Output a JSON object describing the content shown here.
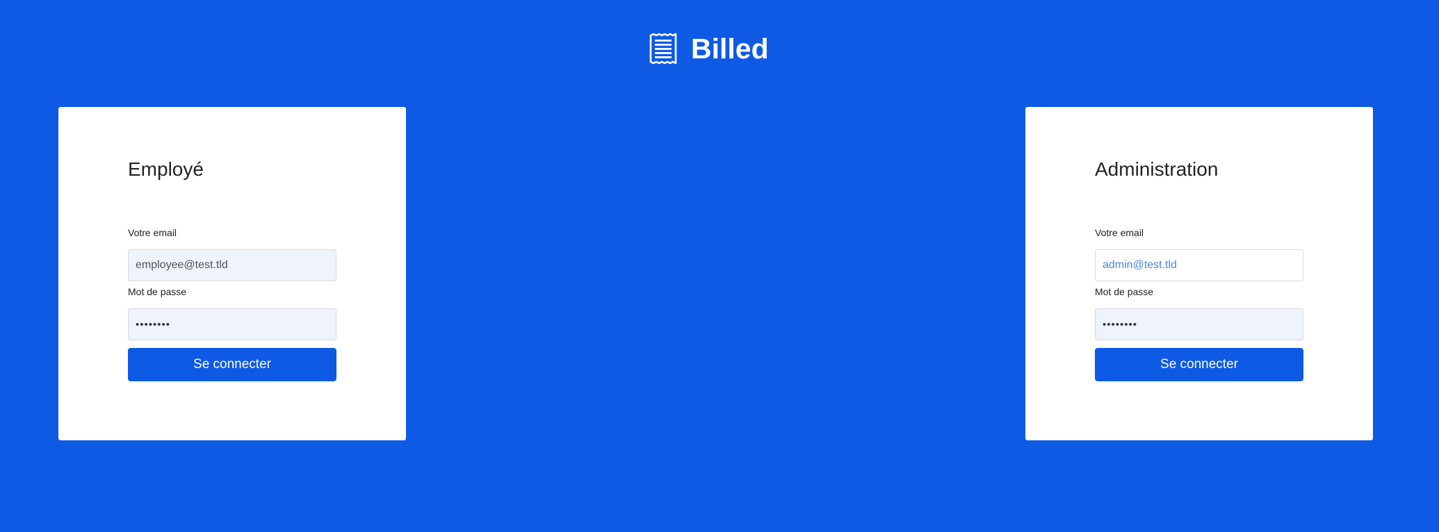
{
  "brand": {
    "icon": "receipt-icon",
    "name": "Billed"
  },
  "employee": {
    "title": "Employé",
    "email_label": "Votre email",
    "email_value": "employee@test.tld",
    "password_label": "Mot de passe",
    "password_value": "••••••••",
    "submit_label": "Se connecter"
  },
  "admin": {
    "title": "Administration",
    "email_label": "Votre email",
    "email_placeholder": "admin@test.tld",
    "password_label": "Mot de passe",
    "password_value": "••••••••",
    "submit_label": "Se connecter"
  },
  "colors": {
    "background": "#0E5AE5",
    "card": "#FFFFFF",
    "button": "#0E5AE5",
    "input_fill": "#EEF3FC",
    "placeholder": "#4A86E8"
  }
}
